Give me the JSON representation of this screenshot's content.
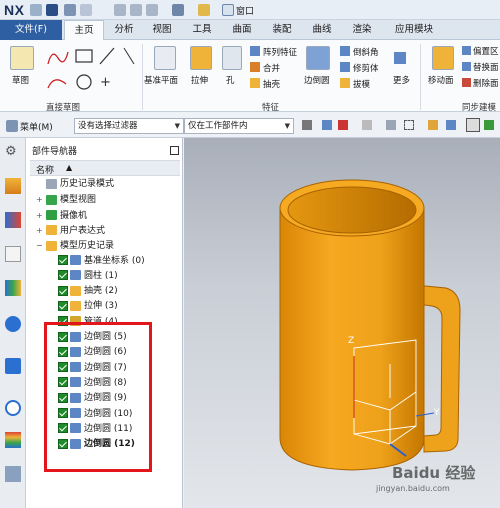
{
  "app": {
    "logo": "NX",
    "window_menu": "窗口"
  },
  "menubar": {
    "file": "文件(F)",
    "tabs": [
      "主页",
      "分析",
      "视图",
      "工具",
      "曲面",
      "装配",
      "曲线",
      "渲染",
      "应用模块"
    ],
    "active_tab": "主页"
  },
  "ribbon": {
    "sketch": "草图",
    "group_direct_sketch": "直接草图",
    "datum_plane": "基准平面",
    "extrude": "拉伸",
    "hole": "孔",
    "pattern_feature": "阵列特征",
    "unite": "合并",
    "shell": "抽壳",
    "edge_blend": "边倒圆",
    "chamfer": "倒斜角",
    "trim_body": "修剪体",
    "draft": "拔模",
    "more": "更多",
    "group_feature": "特征",
    "move_face": "移动面",
    "offset_region": "偏置区",
    "replace_face": "替换面",
    "delete_face": "删除面",
    "group_sync": "同步建模"
  },
  "cmdbar": {
    "menu": "菜单(M)",
    "filter": "没有选择过滤器",
    "scope": "仅在工作部件内"
  },
  "navigator": {
    "title": "部件导航器",
    "col_name": "名称",
    "items": [
      {
        "label": "历史记录模式",
        "indent": 0
      },
      {
        "label": "模型视图",
        "indent": 0
      },
      {
        "label": "摄像机",
        "indent": 0
      },
      {
        "label": "用户表达式",
        "indent": 0
      },
      {
        "label": "模型历史记录",
        "indent": 0
      },
      {
        "label": "基准坐标系 (0)",
        "indent": 1
      },
      {
        "label": "圆柱 (1)",
        "indent": 1
      },
      {
        "label": "抽壳 (2)",
        "indent": 1
      },
      {
        "label": "拉伸 (3)",
        "indent": 1
      },
      {
        "label": "管道 (4)",
        "indent": 1
      },
      {
        "label": "边倒圆 (5)",
        "indent": 1
      },
      {
        "label": "边倒圆 (6)",
        "indent": 1
      },
      {
        "label": "边倒圆 (7)",
        "indent": 1
      },
      {
        "label": "边倒圆 (8)",
        "indent": 1
      },
      {
        "label": "边倒圆 (9)",
        "indent": 1
      },
      {
        "label": "边倒圆 (10)",
        "indent": 1
      },
      {
        "label": "边倒圆 (11)",
        "indent": 1
      },
      {
        "label": "边倒圆 (12)",
        "indent": 1
      }
    ]
  },
  "viewport": {
    "axis_z": "Z",
    "axis_y": "Y",
    "watermark": "Baidu 经验",
    "watermark_url": "jingyan.baidu.com"
  },
  "colors": {
    "accent": "#2e5fa3",
    "highlight_box": "#e2161b",
    "model": "#f0a013"
  }
}
